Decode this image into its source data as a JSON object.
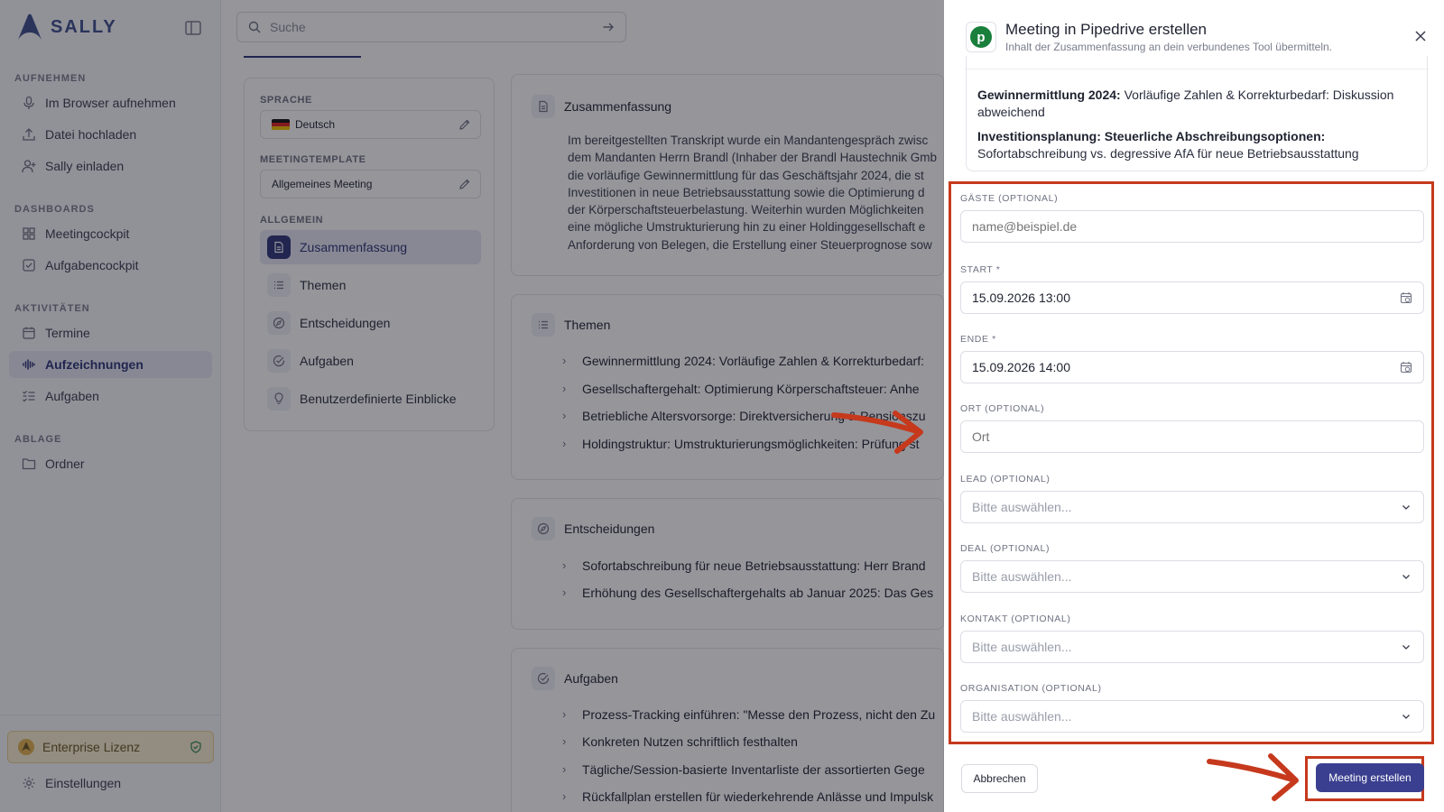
{
  "brand": {
    "name": "SALLY"
  },
  "sidebar": {
    "sections": [
      {
        "title": "AUFNEHMEN"
      },
      {
        "title": "DASHBOARDS"
      },
      {
        "title": "AKTIVITÄTEN"
      },
      {
        "title": "ABLAGE"
      }
    ],
    "items": [
      {
        "label": "Im Browser aufnehmen",
        "icon": "microphone-icon"
      },
      {
        "label": "Datei hochladen",
        "icon": "upload-icon"
      },
      {
        "label": "Sally einladen",
        "icon": "user-plus-icon"
      },
      {
        "label": "Meetingcockpit",
        "icon": "grid-icon"
      },
      {
        "label": "Aufgabencockpit",
        "icon": "checkbox-icon"
      },
      {
        "label": "Termine",
        "icon": "calendar-icon"
      },
      {
        "label": "Aufzeichnungen",
        "icon": "waveform-icon",
        "active": true
      },
      {
        "label": "Aufgaben",
        "icon": "list-check-icon"
      },
      {
        "label": "Ordner",
        "icon": "folder-icon"
      }
    ],
    "license": "Enterprise Lizenz",
    "settings": "Einstellungen"
  },
  "search": {
    "placeholder": "Suche"
  },
  "settings_card": {
    "language_label": "SPRACHE",
    "language_value": "Deutsch",
    "template_label": "MEETINGTEMPLATE",
    "template_value": "Allgemeines Meeting",
    "general_label": "ALLGEMEIN",
    "sections": [
      {
        "label": "Zusammenfassung",
        "active": true
      },
      {
        "label": "Themen"
      },
      {
        "label": "Entscheidungen"
      },
      {
        "label": "Aufgaben"
      },
      {
        "label": "Benutzerdefinierte Einblicke"
      }
    ]
  },
  "content": {
    "summary": {
      "title": "Zusammenfassung",
      "lines": [
        "Im bereitgestellten Transkript wurde ein Mandantengespräch zwisc",
        "dem Mandanten Herrn Brandl (Inhaber der Brandl Haustechnik Gmb",
        "die vorläufige Gewinnermittlung für das Geschäftsjahr 2024, die st",
        "Investitionen in neue Betriebsausstattung sowie die Optimierung d",
        "der Körperschaftsteuerbelastung. Weiterhin wurden Möglichkeiten",
        "eine mögliche Umstrukturierung hin zu einer Holdinggesellschaft e",
        "Anforderung von Belegen, die Erstellung einer Steuerprognose sow"
      ]
    },
    "topics": {
      "title": "Themen",
      "items": [
        "Gewinnermittlung 2024: Vorläufige Zahlen & Korrekturbedarf:",
        "Gesellschaftergehalt: Optimierung Körperschaftsteuer: Anhe",
        "Betriebliche Altersvorsorge: Direktversicherung & Pensionszu",
        "Holdingstruktur: Umstrukturierungsmöglichkeiten: Prüfung st"
      ]
    },
    "decisions": {
      "title": "Entscheidungen",
      "items": [
        "Sofortabschreibung für neue Betriebsausstattung: Herr Brand",
        "Erhöhung des Gesellschaftergehalts ab Januar 2025: Das Ges"
      ]
    },
    "tasks": {
      "title": "Aufgaben",
      "items": [
        "Prozess-Tracking einführen: \"Messe den Prozess, nicht den Zu",
        "Konkreten Nutzen schriftlich festhalten",
        "Tägliche/Session-basierte Inventarliste der assortierten Gege",
        "Rückfallplan erstellen für wiederkehrende Anlässe und Impulsk"
      ]
    }
  },
  "modal": {
    "title": "Meeting in Pipedrive erstellen",
    "subtitle": "Inhalt der Zusammenfassung an dein verbundenes Tool übermitteln.",
    "logo_letter": "p",
    "summary_items": [
      {
        "bold": "Gewinnermittlung 2024:",
        "text": " Vorläufige Zahlen & Korrekturbedarf: Diskussion abweichend"
      },
      {
        "bold": "Investitionsplanung: Steuerliche Abschreibungsoptionen:",
        "text": " Sofortabschreibung vs. degressive AfA für neue Betriebsausstattung"
      }
    ],
    "fields": {
      "guests": {
        "label": "GÄSTE (OPTIONAL)",
        "placeholder": "name@beispiel.de",
        "value": ""
      },
      "start": {
        "label": "START *",
        "value": "15.09.2026 13:00"
      },
      "end": {
        "label": "ENDE *",
        "value": "15.09.2026 14:00"
      },
      "location": {
        "label": "ORT (OPTIONAL)",
        "placeholder": "Ort",
        "value": ""
      },
      "lead": {
        "label": "LEAD (OPTIONAL)",
        "value": "Bitte auswählen..."
      },
      "deal": {
        "label": "DEAL (OPTIONAL)",
        "value": "Bitte auswählen..."
      },
      "contact": {
        "label": "KONTAKT (OPTIONAL)",
        "value": "Bitte auswählen..."
      },
      "organisation": {
        "label": "ORGANISATION (OPTIONAL)",
        "value": "Bitte auswählen..."
      }
    },
    "cancel_label": "Abbrechen",
    "submit_label": "Meeting erstellen"
  },
  "colors": {
    "brand_navy": "#2c3477",
    "primary_button": "#3a3f8f",
    "highlight_annotation": "#c6391d",
    "pipedrive_green": "#1a7f3c",
    "license_bg": "#fbefd0"
  }
}
